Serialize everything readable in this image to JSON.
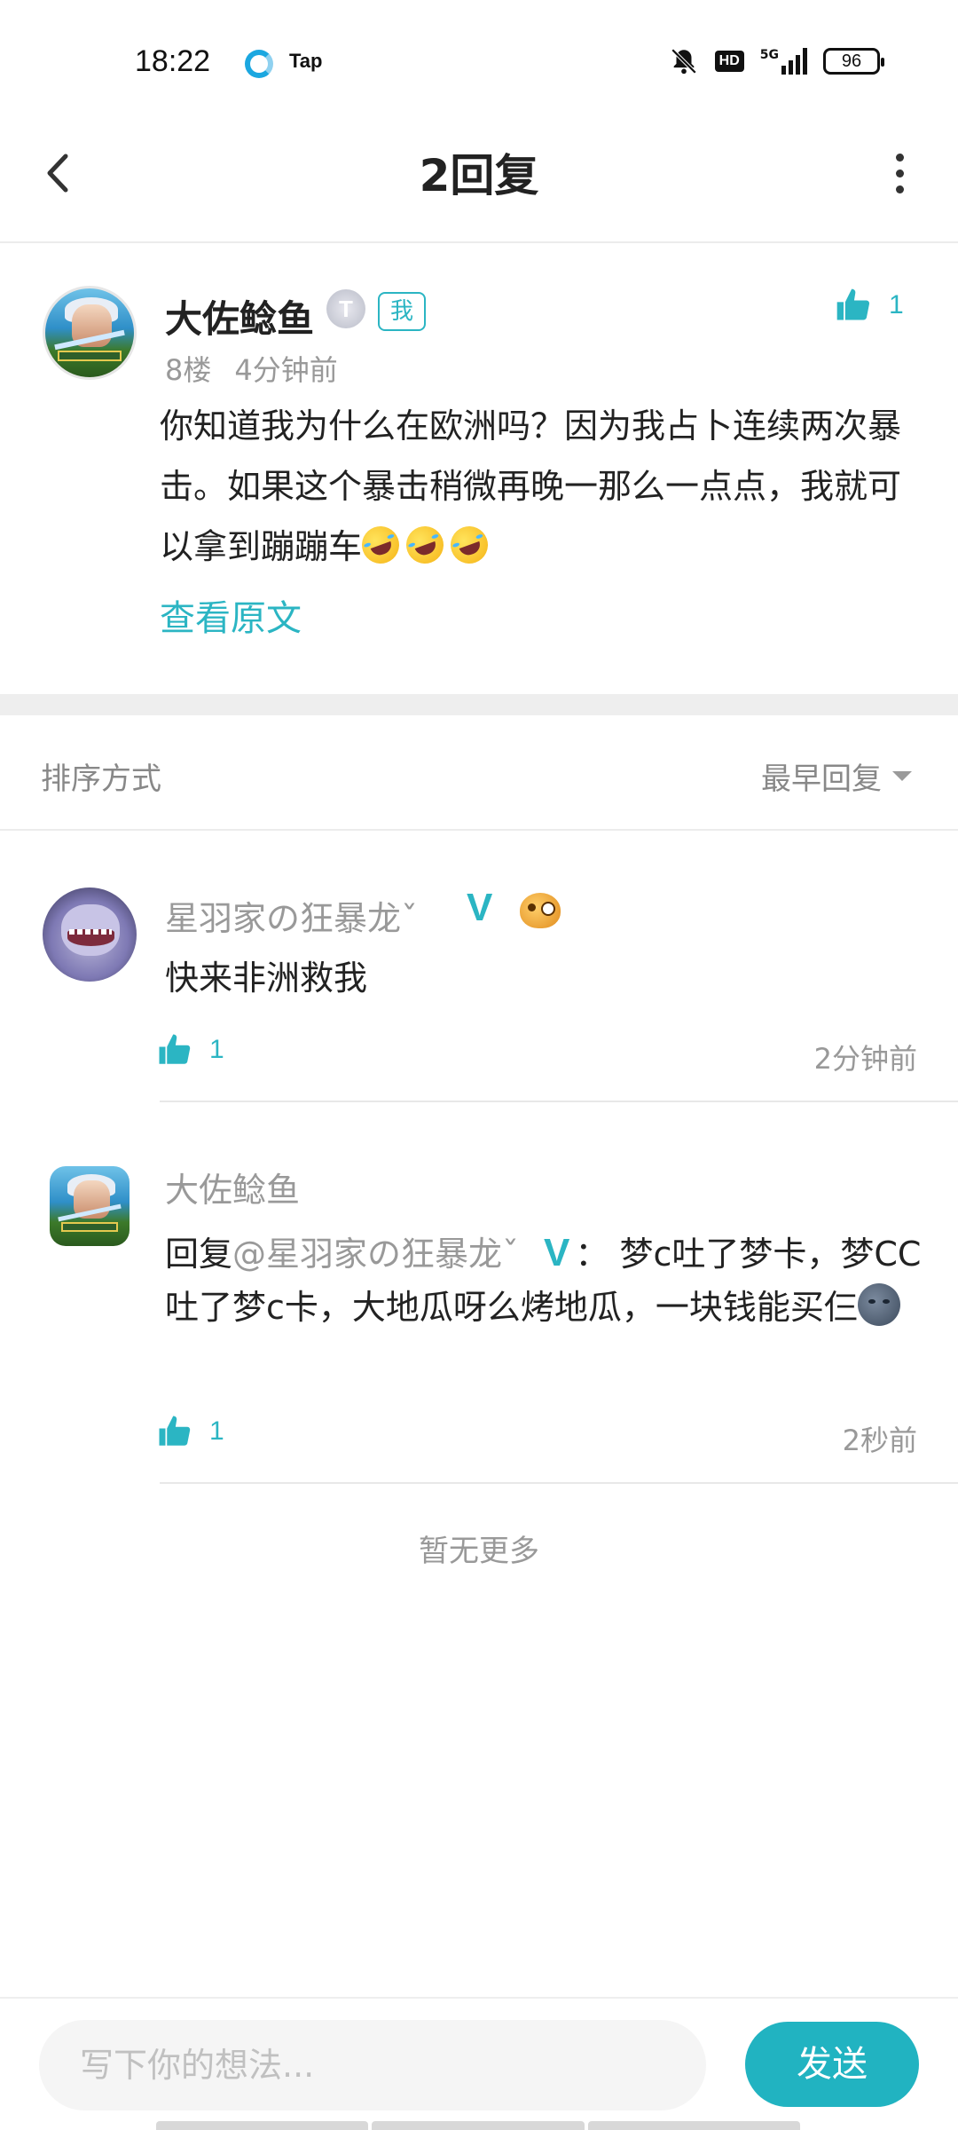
{
  "status_bar": {
    "time": "18:22",
    "app_label": "Tap",
    "hd": "HD",
    "network": "5G",
    "battery": "96"
  },
  "header": {
    "title": "2回复"
  },
  "main_comment": {
    "author": "大佐鲶鱼",
    "level_badge": "T",
    "me_badge": "我",
    "likes": "1",
    "floor": "8楼",
    "time": "4分钟前",
    "content": "你知道我为什么在欧洲吗？因为我占卜连续两次暴击。如果这个暴击稍微再晚一那么一点点，我就可以拿到蹦蹦车",
    "view_original": "查看原文"
  },
  "sort": {
    "label": "排序方式",
    "value": "最早回复"
  },
  "replies": [
    {
      "author": "星羽家の狂暴龙ˇ",
      "verified": "V",
      "text": "快来非洲救我",
      "likes": "1",
      "time": "2分钟前"
    },
    {
      "author": "大佐鲶鱼",
      "reply_prefix": "回复",
      "mention": "@星羽家の狂暴龙ˇ",
      "mention_v": "V",
      "text": "：  梦c吐了梦卡，梦CC吐了梦c卡，大地瓜呀么烤地瓜，一块钱能买仨",
      "likes": "1",
      "time": "2秒前"
    }
  ],
  "no_more": "暂无更多",
  "composer": {
    "placeholder": "写下你的想法...",
    "send_label": "发送"
  },
  "colors": {
    "accent": "#2bb5c3",
    "send_button": "#21b3c1"
  }
}
